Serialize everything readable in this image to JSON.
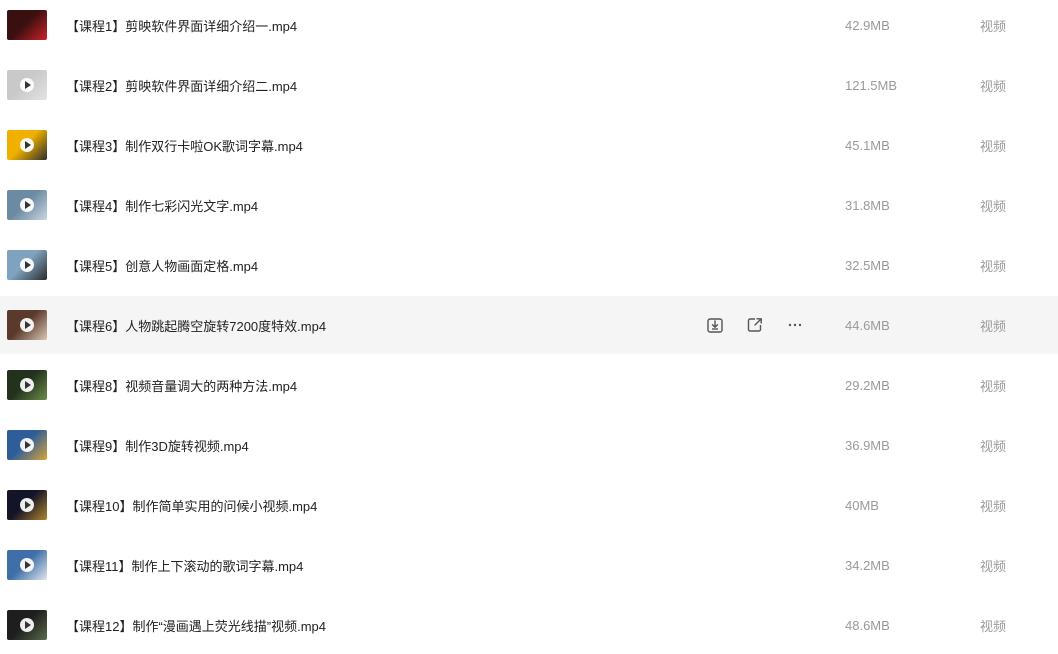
{
  "files": [
    {
      "name": "【课程1】剪映软件界面详细介绍一.mp4",
      "size": "42.9MB",
      "type": "视频",
      "thumb_colors": [
        "#3a0f10",
        "#c8222a"
      ]
    },
    {
      "name": "【课程2】剪映软件界面详细介绍二.mp4",
      "size": "121.5MB",
      "type": "视频",
      "thumb_colors": [
        "#c9c9c9",
        "#e3e3e3"
      ]
    },
    {
      "name": "【课程3】制作双行卡啦OK歌词字幕.mp4",
      "size": "45.1MB",
      "type": "视频",
      "thumb_colors": [
        "#f0b000",
        "#2d2d2d"
      ]
    },
    {
      "name": "【课程4】制作七彩闪光文字.mp4",
      "size": "31.8MB",
      "type": "视频",
      "thumb_colors": [
        "#6c8aa2",
        "#c9d6e0"
      ]
    },
    {
      "name": "【课程5】创意人物画面定格.mp4",
      "size": "32.5MB",
      "type": "视频",
      "thumb_colors": [
        "#7ea2c0",
        "#2b2b2b"
      ]
    },
    {
      "name": "【课程6】人物跳起腾空旋转7200度特效.mp4",
      "size": "44.6MB",
      "type": "视频",
      "thumb_colors": [
        "#5b3a2e",
        "#d9c6b2"
      ]
    },
    {
      "name": "【课程8】视频音量调大的两种方法.mp4",
      "size": "29.2MB",
      "type": "视频",
      "thumb_colors": [
        "#22321c",
        "#6e8d4a"
      ]
    },
    {
      "name": "【课程9】制作3D旋转视频.mp4",
      "size": "36.9MB",
      "type": "视频",
      "thumb_colors": [
        "#2f5d99",
        "#d9a536"
      ]
    },
    {
      "name": "【课程10】制作简单实用的问候小视频.mp4",
      "size": "40MB",
      "type": "视频",
      "thumb_colors": [
        "#141428",
        "#b0852e"
      ]
    },
    {
      "name": "【课程11】制作上下滚动的歌词字幕.mp4",
      "size": "34.2MB",
      "type": "视频",
      "thumb_colors": [
        "#3f6ea8",
        "#e0e6ee"
      ]
    },
    {
      "name": "【课程12】制作“漫画遇上荧光线描”视频.mp4",
      "size": "48.6MB",
      "type": "视频",
      "thumb_colors": [
        "#1e1e1e",
        "#5a6a4a"
      ]
    }
  ],
  "hover_row_index": 5,
  "actions": {
    "download_icon": "download-icon",
    "share_icon": "share-icon",
    "more_icon": "more-icon"
  }
}
